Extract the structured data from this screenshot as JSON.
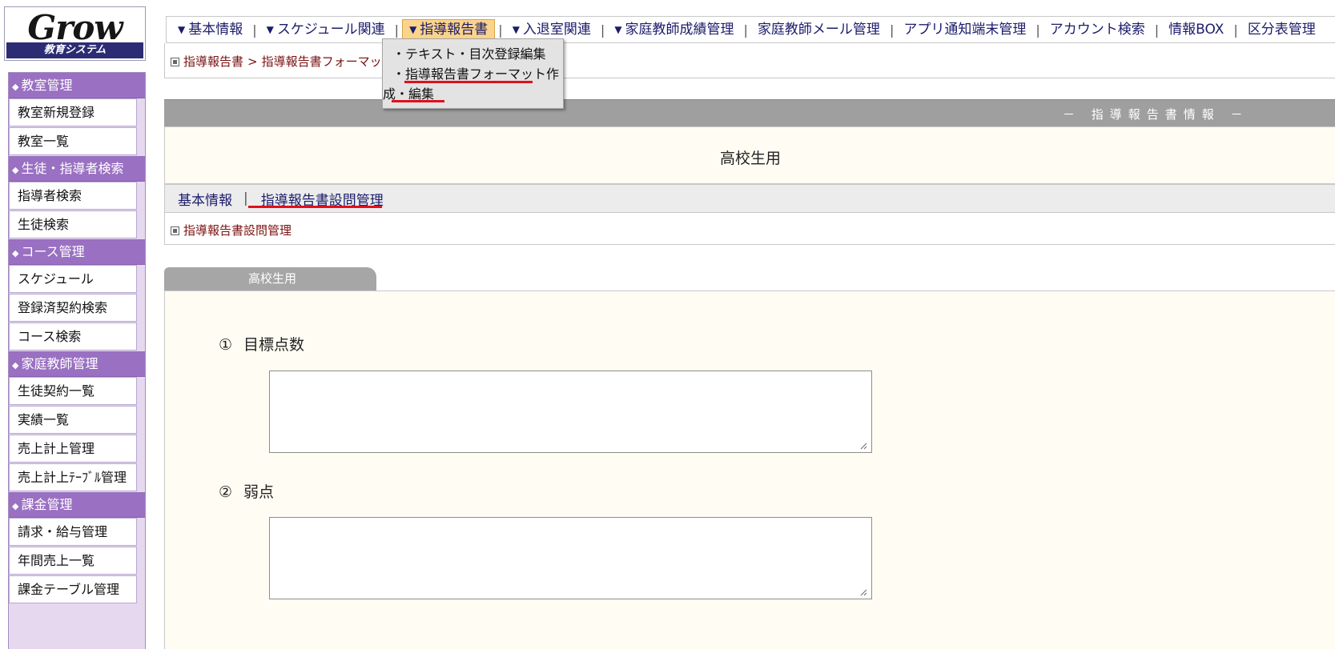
{
  "sidebar": {
    "logo_word": "Grow",
    "logo_sub": "教育システム",
    "sections": [
      {
        "title": "教室管理",
        "items": [
          "教室新規登録",
          "教室一覧"
        ]
      },
      {
        "title": "生徒・指導者検索",
        "items": [
          "指導者検索",
          "生徒検索"
        ]
      },
      {
        "title": "コース管理",
        "items": [
          "スケジュール",
          "登録済契約検索",
          "コース検索"
        ]
      },
      {
        "title": "家庭教師管理",
        "items": [
          "生徒契約一覧",
          "実績一覧",
          "売上計上管理",
          "売上計上ﾃｰﾌﾞﾙ管理"
        ]
      },
      {
        "title": "課金管理",
        "items": [
          "請求・給与管理",
          "年間売上一覧",
          "課金テーブル管理"
        ]
      }
    ]
  },
  "topnav": {
    "items": [
      {
        "label": "基本情報",
        "has_arrow": true
      },
      {
        "label": "スケジュール関連",
        "has_arrow": true
      },
      {
        "label": "指導報告書",
        "has_arrow": true,
        "active": true
      },
      {
        "label": "入退室関連",
        "has_arrow": true
      },
      {
        "label": "家庭教師成績管理",
        "has_arrow": true
      },
      {
        "label": "家庭教師メール管理",
        "has_arrow": false
      },
      {
        "label": "アプリ通知端末管理",
        "has_arrow": false
      },
      {
        "label": "アカウント検索",
        "has_arrow": false
      },
      {
        "label": "情報BOX",
        "has_arrow": false
      },
      {
        "label": "区分表管理",
        "has_arrow": false
      }
    ],
    "dropdown": {
      "item1": "・テキスト・目次登録編集",
      "item2_line1": "・指導報告書フォーマット作",
      "item2_line2": "成・編集"
    }
  },
  "breadcrumb": {
    "part1": "指導報告書",
    "separator": ">",
    "part2": "指導報告書フォーマット"
  },
  "info": {
    "header": "－ 指導報告書情報 －",
    "title": "高校生用"
  },
  "subtabs": {
    "tab1": "基本情報",
    "separator": "|",
    "tab2": "指導報告書設問管理",
    "crumb": "指導報告書設問管理"
  },
  "content": {
    "tab_label": "高校生用",
    "questions": [
      {
        "num": "①",
        "label": "目標点数",
        "value": ""
      },
      {
        "num": "②",
        "label": "弱点",
        "value": ""
      }
    ]
  },
  "colors": {
    "sidebar_header": "#9a70c2",
    "highlight_underline": "#e0101c",
    "active_tab": "#fbd48c",
    "nav_text": "#1c1c6c",
    "crumb_text": "#7a1010"
  }
}
